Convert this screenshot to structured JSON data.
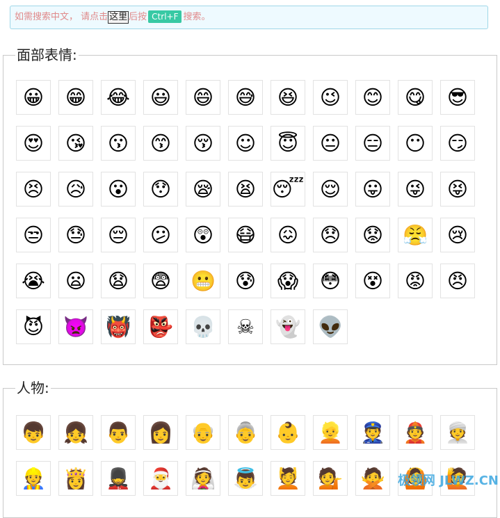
{
  "notice": {
    "prefix": "如需搜索中文， 请点击",
    "here": "这里",
    "middle": "后按",
    "kbd": "Ctrl+F",
    "suffix": "搜索。"
  },
  "sections": [
    {
      "title": "面部表情:",
      "emojis": [
        "😀",
        "😁",
        "😂",
        "😃",
        "😄",
        "😅",
        "😆",
        "😉",
        "😊",
        "😋",
        "😎",
        "😍",
        "😘",
        "😗",
        "😙",
        "😚",
        "☺",
        "😇",
        "😐",
        "😑",
        "😶",
        "😏",
        "😣",
        "😥",
        "😮",
        "😯",
        "😪",
        "😫",
        "😴",
        "😌",
        "😛",
        "😜",
        "😝",
        "😒",
        "😓",
        "😔",
        "😕",
        "😲",
        "😷",
        "😖",
        "😞",
        "😟",
        "😤",
        "😢",
        "😭",
        "😦",
        "😧",
        "😨",
        "😬",
        "😰",
        "😱",
        "😳",
        "😵",
        "😡",
        "😠",
        "😈",
        "👿",
        "👹",
        "👺",
        "💀",
        "☠",
        "👻",
        "👽"
      ]
    },
    {
      "title": "人物:",
      "emojis": [
        "👦",
        "👧",
        "👨",
        "👩",
        "👴",
        "👵",
        "👶",
        "👱",
        "👮",
        "👲",
        "👳",
        "👷",
        "👸",
        "💂",
        "🎅",
        "👰",
        "👼",
        "💆",
        "💁",
        "🙅",
        "🙆",
        "🙋"
      ]
    }
  ],
  "watermark": "极领网 JLWZ.CN"
}
